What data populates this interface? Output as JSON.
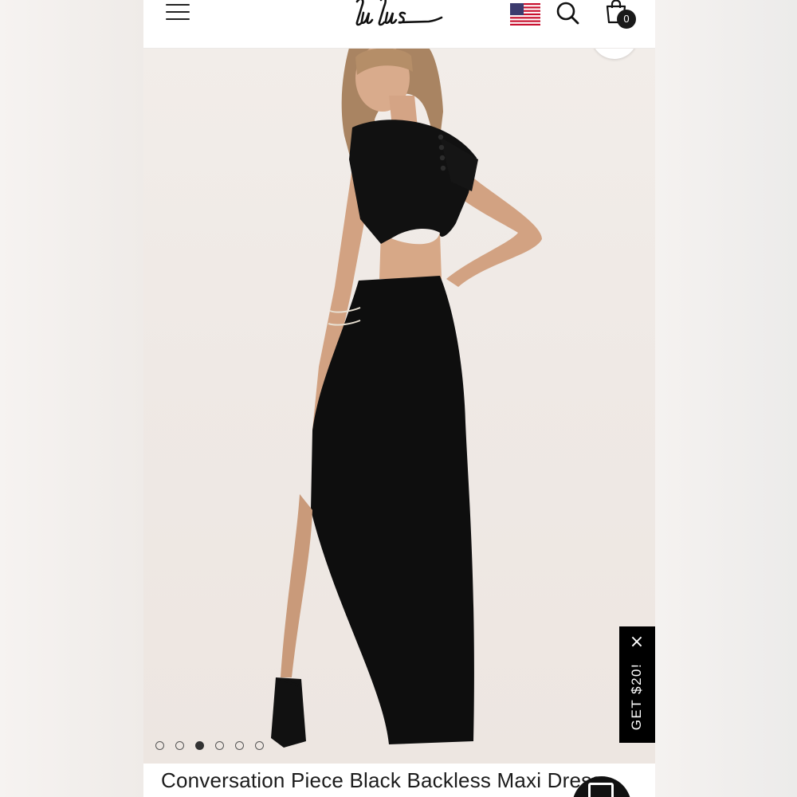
{
  "header": {
    "menu_icon": "hamburger-menu-icon",
    "logo_text": "Lulus",
    "flag_icon": "us-flag-icon",
    "search_icon": "search-icon",
    "bag_icon": "shopping-bag-icon",
    "bag_count": "0"
  },
  "gallery": {
    "image_description": "Model wearing black backless maxi dress",
    "zoom_icon": "zoom-icon",
    "dots": [
      {
        "active": false
      },
      {
        "active": false
      },
      {
        "active": true
      },
      {
        "active": false
      },
      {
        "active": false
      },
      {
        "active": false
      }
    ]
  },
  "promo": {
    "label": "GET $20!",
    "close_icon": "close-icon"
  },
  "product": {
    "title": "Conversation Piece Black Backless Maxi Dress"
  },
  "chat": {
    "icon": "chat-icon"
  },
  "colors": {
    "accent": "#000000",
    "background": "#ffffff",
    "photo_bg": "#efe9e5"
  }
}
